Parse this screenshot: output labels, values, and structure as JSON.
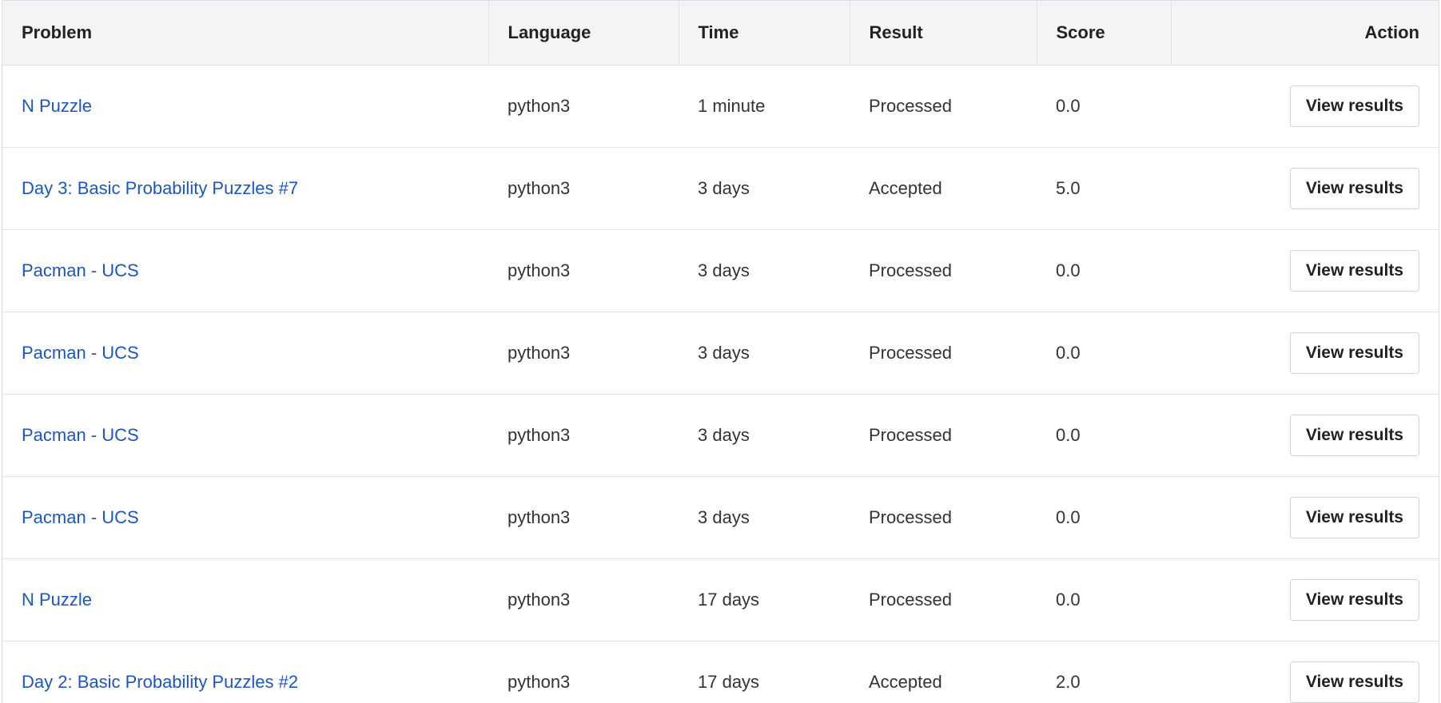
{
  "table": {
    "headers": {
      "problem": "Problem",
      "language": "Language",
      "time": "Time",
      "result": "Result",
      "score": "Score",
      "action": "Action"
    },
    "rows": [
      {
        "problem": "N Puzzle",
        "language": "python3",
        "time": "1 minute",
        "result": "Processed",
        "score": "0.0",
        "action": "View results"
      },
      {
        "problem": "Day 3: Basic Probability Puzzles #7",
        "language": "python3",
        "time": "3 days",
        "result": "Accepted",
        "score": "5.0",
        "action": "View results"
      },
      {
        "problem": "Pacman - UCS",
        "language": "python3",
        "time": "3 days",
        "result": "Processed",
        "score": "0.0",
        "action": "View results"
      },
      {
        "problem": "Pacman - UCS",
        "language": "python3",
        "time": "3 days",
        "result": "Processed",
        "score": "0.0",
        "action": "View results"
      },
      {
        "problem": "Pacman - UCS",
        "language": "python3",
        "time": "3 days",
        "result": "Processed",
        "score": "0.0",
        "action": "View results"
      },
      {
        "problem": "Pacman - UCS",
        "language": "python3",
        "time": "3 days",
        "result": "Processed",
        "score": "0.0",
        "action": "View results"
      },
      {
        "problem": "N Puzzle",
        "language": "python3",
        "time": "17 days",
        "result": "Processed",
        "score": "0.0",
        "action": "View results"
      },
      {
        "problem": "Day 2: Basic Probability Puzzles #2",
        "language": "python3",
        "time": "17 days",
        "result": "Accepted",
        "score": "2.0",
        "action": "View results"
      }
    ]
  },
  "colors": {
    "link": "#1a56c4",
    "header_background": "#f3f4f6",
    "border": "#dcdee2"
  }
}
